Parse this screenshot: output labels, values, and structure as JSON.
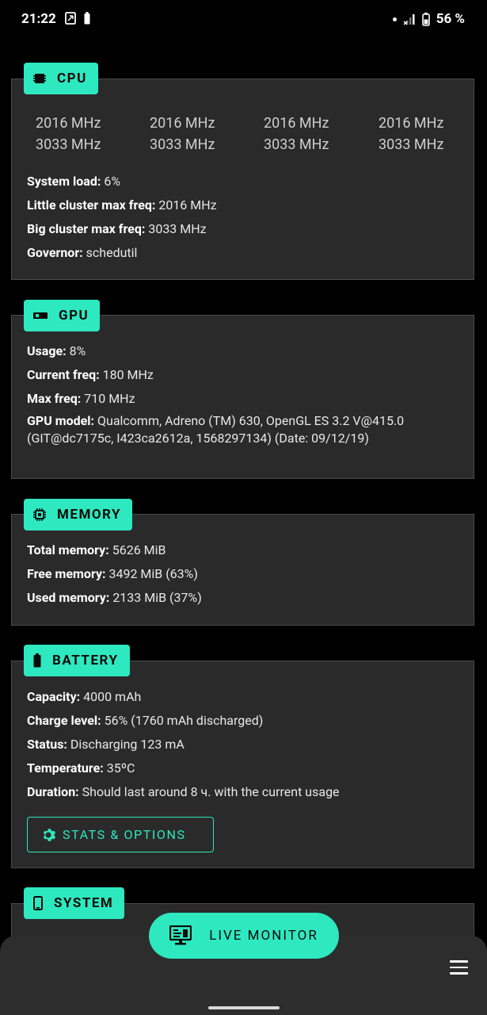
{
  "status_bar": {
    "time": "21:22",
    "battery_percent": "56 %"
  },
  "cpu": {
    "title": "CPU",
    "freq_grid": [
      [
        "2016 MHz",
        "3033 MHz"
      ],
      [
        "2016 MHz",
        "3033 MHz"
      ],
      [
        "2016 MHz",
        "3033 MHz"
      ],
      [
        "2016 MHz",
        "3033 MHz"
      ]
    ],
    "rows": [
      {
        "label": "System load:",
        "value": "6%"
      },
      {
        "label": "Little cluster max freq:",
        "value": "2016 MHz"
      },
      {
        "label": "Big cluster max freq:",
        "value": "3033 MHz"
      },
      {
        "label": "Governor:",
        "value": "schedutil"
      }
    ]
  },
  "gpu": {
    "title": "GPU",
    "rows": [
      {
        "label": "Usage:",
        "value": "8%"
      },
      {
        "label": "Current freq:",
        "value": "180 MHz"
      },
      {
        "label": "Max freq:",
        "value": "710 MHz"
      },
      {
        "label": "GPU model:",
        "value": "Qualcomm, Adreno (TM) 630, OpenGL ES 3.2 V@415.0 (GIT@dc7175c, I423ca2612a, 1568297134) (Date: 09/12/19)"
      }
    ]
  },
  "memory": {
    "title": "MEMORY",
    "rows": [
      {
        "label": "Total memory:",
        "value": "5626 MiB"
      },
      {
        "label": "Free memory:",
        "value": "3492 MiB (63%)"
      },
      {
        "label": "Used memory:",
        "value": "2133 MiB (37%)"
      }
    ]
  },
  "battery": {
    "title": "BATTERY",
    "rows": [
      {
        "label": "Capacity:",
        "value": "4000 mAh"
      },
      {
        "label": "Charge level:",
        "value": "56% (1760 mAh discharged)"
      },
      {
        "label": "Status:",
        "value": "Discharging 123 mA"
      },
      {
        "label": "Temperature:",
        "value": "35ºC"
      },
      {
        "label": "Duration:",
        "value": "Should last around 8 ч. with the current usage"
      }
    ],
    "stats_button": "STATS & OPTIONS"
  },
  "system": {
    "title": "SYSTEM"
  },
  "fab": {
    "label": "LIVE MONITOR"
  },
  "colors": {
    "accent": "#2ee8bf",
    "card_bg": "#2a2a2a",
    "background": "#000000"
  },
  "icons": {
    "cpu": "cpu-chip-icon",
    "gpu": "gpu-card-icon",
    "memory": "memory-chip-icon",
    "battery": "battery-icon",
    "system": "phone-icon",
    "stats": "gear-icon",
    "fab": "monitor-icon",
    "menu": "hamburger-menu-icon"
  }
}
